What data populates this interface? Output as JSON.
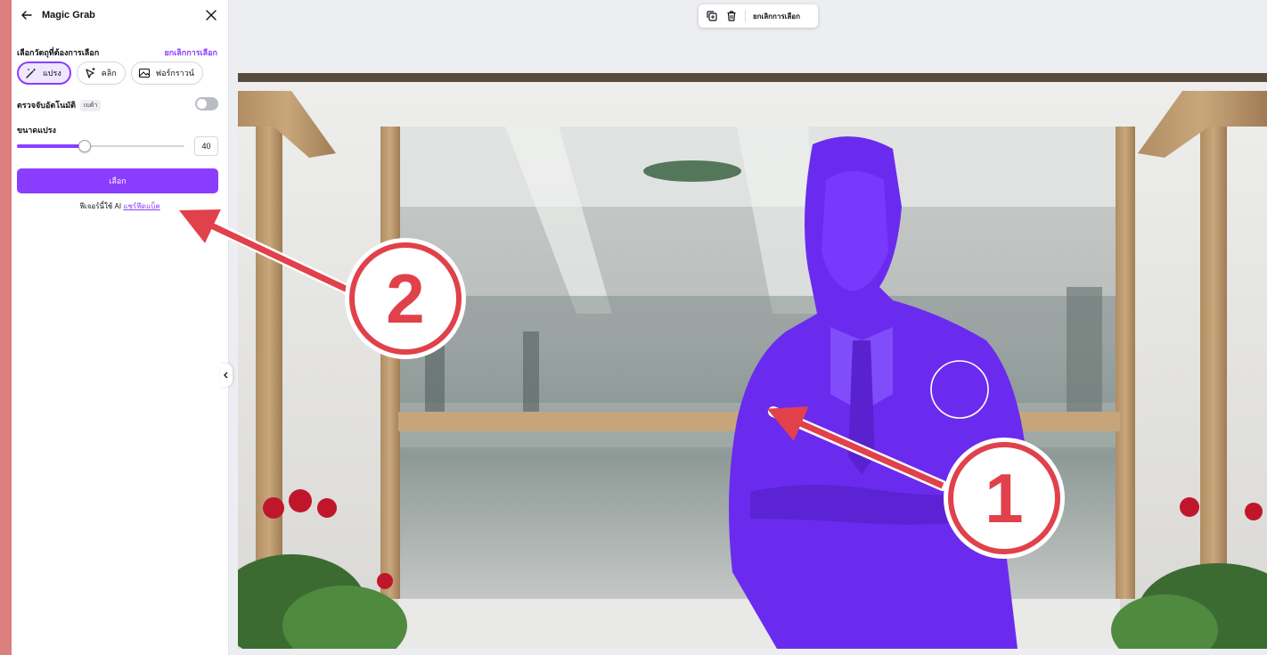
{
  "app": {
    "panel_title": "Magic Grab",
    "section_label": "เลือกวัตถุที่ต้องการเลือก",
    "deselect_link": "ยกเลิกการเลือก",
    "tools": [
      {
        "label": "แปรง",
        "icon": "magic-brush-icon",
        "active": true
      },
      {
        "label": "คลิก",
        "icon": "magic-click-icon",
        "active": false
      },
      {
        "label": "ฟอร์กราวน์",
        "icon": "foreground-icon",
        "active": false
      }
    ],
    "auto_detect_label": "ตรวจจับอัตโนมัติ",
    "beta_badge": "เบต้า",
    "auto_detect_on": false,
    "brush_size_label": "ขนาดแปรง",
    "brush_size_value": "40",
    "brush_size_fraction": 0.4,
    "select_button": "เลือก",
    "ai_note_prefix": "ฟีเจอร์นี้ใช้ AI",
    "ai_note_link": "แชร์ฟีดแบ็ค"
  },
  "toolbar": {
    "deselect_label": "ยกเลิกการเลือก"
  },
  "annotations": {
    "badge_1": "1",
    "badge_2": "2"
  },
  "colors": {
    "accent": "#8b3dff",
    "annotation_red": "#e0414b",
    "selection_overlay": "#7a2bff"
  }
}
